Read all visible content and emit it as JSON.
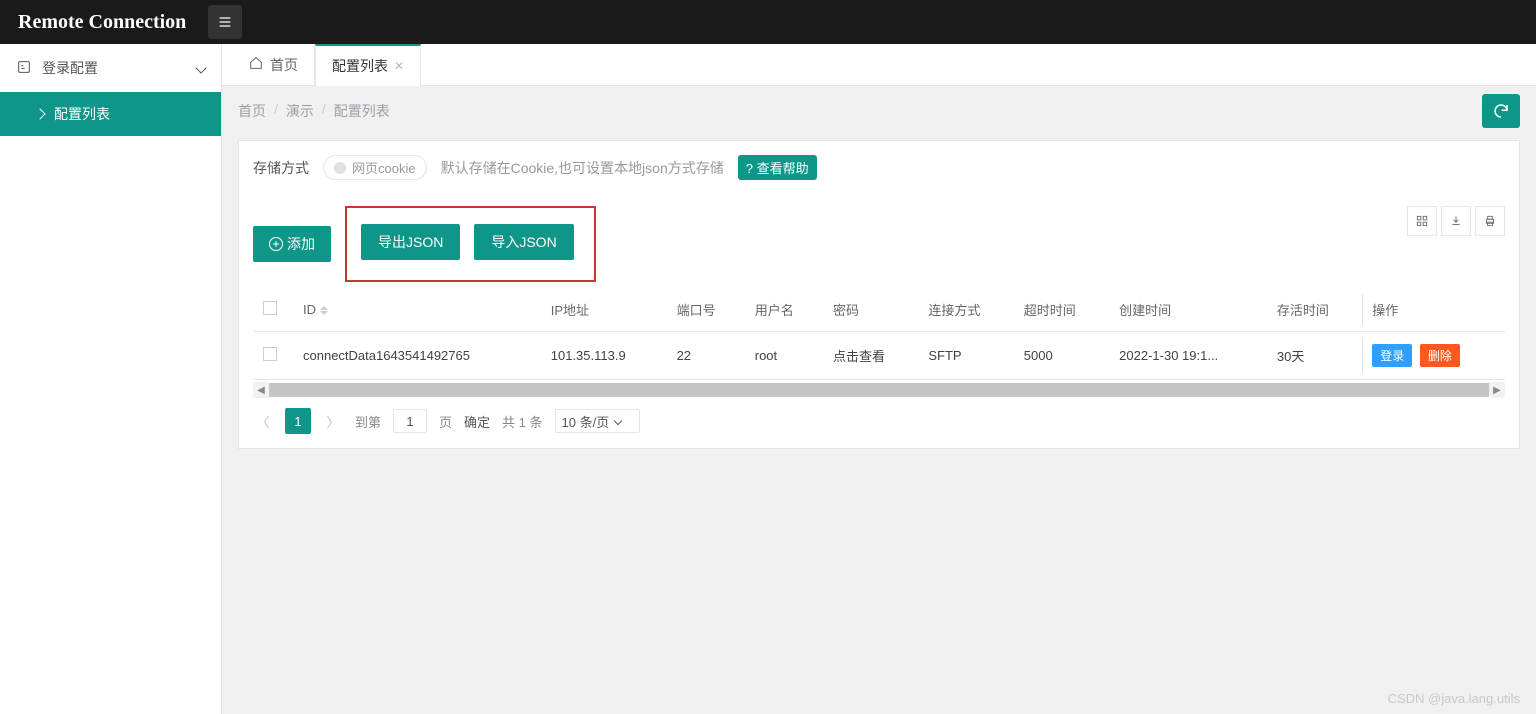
{
  "topbar": {
    "brand": "Remote Connection"
  },
  "sidebar": {
    "group_label": "登录配置",
    "item_label": "配置列表"
  },
  "tabs": {
    "home": "首页",
    "active": "配置列表"
  },
  "breadcrumb": {
    "home": "首页",
    "demo": "演示",
    "current": "配置列表"
  },
  "storage": {
    "title": "存储方式",
    "switch_label": "网页cookie",
    "hint": "默认存储在Cookie,也可设置本地json方式存储",
    "help": "?  查看帮助"
  },
  "toolbar": {
    "add": "添加",
    "export_json": "导出JSON",
    "import_json": "导入JSON"
  },
  "table": {
    "headers": {
      "id": "ID",
      "ip": "IP地址",
      "port": "端口号",
      "user": "用户名",
      "password": "密码",
      "conn_type": "连接方式",
      "timeout": "超时时间",
      "created": "创建时间",
      "alive": "存活时间",
      "ops": "操作"
    },
    "rows": [
      {
        "id": "connectData1643541492765",
        "ip": "101.35.113.9",
        "port": "22",
        "user": "root",
        "password": "点击查看",
        "conn_type": "SFTP",
        "timeout": "5000",
        "created": "2022-1-30 19:1...",
        "alive": "30天"
      }
    ],
    "ops": {
      "login": "登录",
      "delete": "删除"
    }
  },
  "pagination": {
    "current": "1",
    "to_label": "到第",
    "page_input": "1",
    "page_suffix": "页",
    "confirm": "确定",
    "total": "共 1 条",
    "per_page": "10 条/页"
  },
  "watermark": "CSDN @java.lang.utils"
}
